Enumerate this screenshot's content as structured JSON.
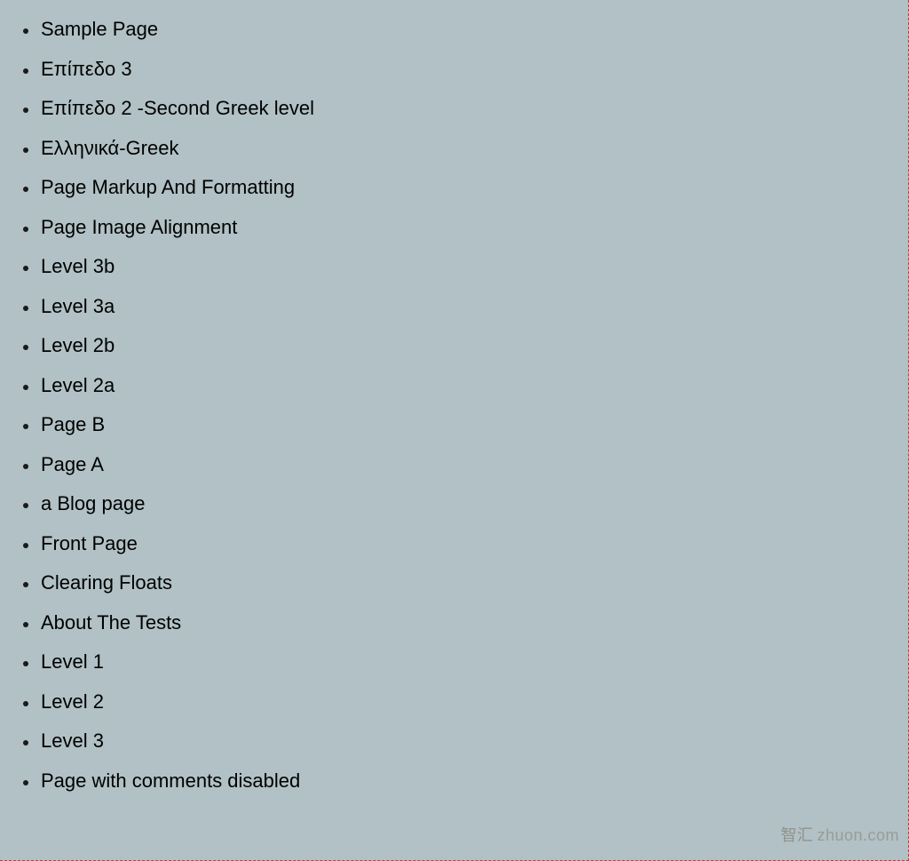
{
  "pages": [
    {
      "label": "Sample Page"
    },
    {
      "label": "Επίπεδο 3"
    },
    {
      "label": "Επίπεδο 2 -Second Greek level"
    },
    {
      "label": "Ελληνικά-Greek"
    },
    {
      "label": "Page Markup And Formatting"
    },
    {
      "label": "Page Image Alignment"
    },
    {
      "label": "Level 3b"
    },
    {
      "label": "Level 3a"
    },
    {
      "label": "Level 2b"
    },
    {
      "label": "Level 2a"
    },
    {
      "label": "Page B"
    },
    {
      "label": "Page A"
    },
    {
      "label": "a Blog page"
    },
    {
      "label": "Front Page"
    },
    {
      "label": "Clearing Floats"
    },
    {
      "label": "About The Tests"
    },
    {
      "label": "Level 1"
    },
    {
      "label": "Level 2"
    },
    {
      "label": "Level 3"
    },
    {
      "label": "Page with comments disabled"
    }
  ],
  "watermark": {
    "zh": "智汇",
    "domain": "zhuon.com"
  }
}
